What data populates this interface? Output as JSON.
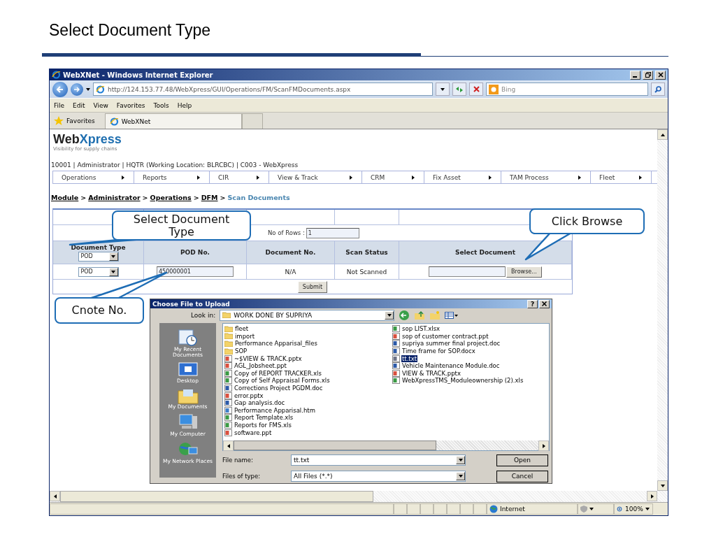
{
  "slide": {
    "title": "Select Document Type"
  },
  "browser": {
    "title": "WebXNet - Windows Internet Explorer",
    "url": "http://124.153.77.48/WebXpress/GUI/Operations/FM/ScanFMDocuments.aspx",
    "search_placeholder": "Bing",
    "menu": [
      "File",
      "Edit",
      "View",
      "Favorites",
      "Tools",
      "Help"
    ],
    "favorites_label": "Favorites",
    "tab": "WebXNet",
    "status": {
      "zone": "Internet",
      "zoom": "100%"
    }
  },
  "page": {
    "logo": {
      "dark": "Web",
      "accent": "Xpress"
    },
    "tagline": "Visibility for supply chains",
    "user_info": "10001 | Administrator | HQTR (Working Location: BLRCBC) | C003 - WebXpress",
    "nav": [
      "Operations",
      "Reports",
      "CIR",
      "View & Track",
      "CRM",
      "Fix Asset",
      "TAM Process",
      "Fleet"
    ],
    "breadcrumb_separator": ">",
    "breadcrumb": [
      {
        "label": "Module",
        "current": false
      },
      {
        "label": "Administrator",
        "current": false
      },
      {
        "label": "Operations",
        "current": false
      },
      {
        "label": "DFM",
        "current": false
      },
      {
        "label": "Scan Documents",
        "current": true
      }
    ],
    "form": {
      "rows_label": "No of Rows :",
      "rows_value": "1",
      "columns": [
        "Document Type",
        "POD No.",
        "Document No.",
        "Scan Status",
        "Select Document"
      ],
      "header_type_value": "POD",
      "rows": [
        {
          "document_type": "POD",
          "pod_no": "450000001",
          "document_no": "N/A",
          "scan_status": "Not Scanned",
          "browse": "Browse..."
        }
      ],
      "submit": "Submit"
    }
  },
  "callouts": [
    {
      "text": "Select Document Type"
    },
    {
      "text": "Click Browse"
    },
    {
      "text": "Cnote No."
    }
  ],
  "dialog": {
    "title": "Choose File to Upload",
    "help": "?",
    "look_in_label": "Look in:",
    "look_in": "WORK DONE BY SUPRIYA",
    "places": [
      "My Recent Documents",
      "Desktop",
      "My Documents",
      "My Computer",
      "My Network Places"
    ],
    "files": [
      {
        "name": "fleet",
        "kind": "folder",
        "selected": false
      },
      {
        "name": "import",
        "kind": "folder",
        "selected": false
      },
      {
        "name": "Performance Apparisal_files",
        "kind": "folder",
        "selected": false
      },
      {
        "name": "SOP",
        "kind": "folder",
        "selected": false
      },
      {
        "name": "~$VIEW & TRACK.pptx",
        "kind": "slides",
        "selected": false
      },
      {
        "name": "AGL_Jobsheet.ppt",
        "kind": "slides",
        "selected": false
      },
      {
        "name": "Copy of REPORT TRACKER.xls",
        "kind": "sheet",
        "selected": false
      },
      {
        "name": "Copy of Self Appraisal Forms.xls",
        "kind": "sheet",
        "selected": false
      },
      {
        "name": "Corrections Project PGDM.doc",
        "kind": "doc",
        "selected": false
      },
      {
        "name": "error.pptx",
        "kind": "slides",
        "selected": false
      },
      {
        "name": "Gap analysis.doc",
        "kind": "doc",
        "selected": false
      },
      {
        "name": "Performance Apparisal.htm",
        "kind": "web",
        "selected": false
      },
      {
        "name": "Report Template.xls",
        "kind": "sheet",
        "selected": false
      },
      {
        "name": "Reports for FMS.xls",
        "kind": "sheet",
        "selected": false
      },
      {
        "name": "software.ppt",
        "kind": "slides",
        "selected": false
      },
      {
        "name": "sop LIST.xlsx",
        "kind": "sheet",
        "selected": false
      },
      {
        "name": "sop of customer contract.ppt",
        "kind": "slides",
        "selected": false
      },
      {
        "name": "supriya  summer final project.doc",
        "kind": "doc",
        "selected": false
      },
      {
        "name": "Time frame for SOP.docx",
        "kind": "doc",
        "selected": false
      },
      {
        "name": "tt.txt",
        "kind": "text",
        "selected": true
      },
      {
        "name": "Vehicle Maintenance Module.doc",
        "kind": "doc",
        "selected": false
      },
      {
        "name": "VIEW & TRACK.pptx",
        "kind": "slides",
        "selected": false
      },
      {
        "name": "WebXpressTMS_Moduleownership (2).xls",
        "kind": "sheet",
        "selected": false
      }
    ],
    "file_name_label": "File name:",
    "file_name": "tt.txt",
    "file_type_label": "Files of type:",
    "file_type": "All Files (*.*)",
    "buttons": [
      "Open",
      "Cancel"
    ]
  }
}
